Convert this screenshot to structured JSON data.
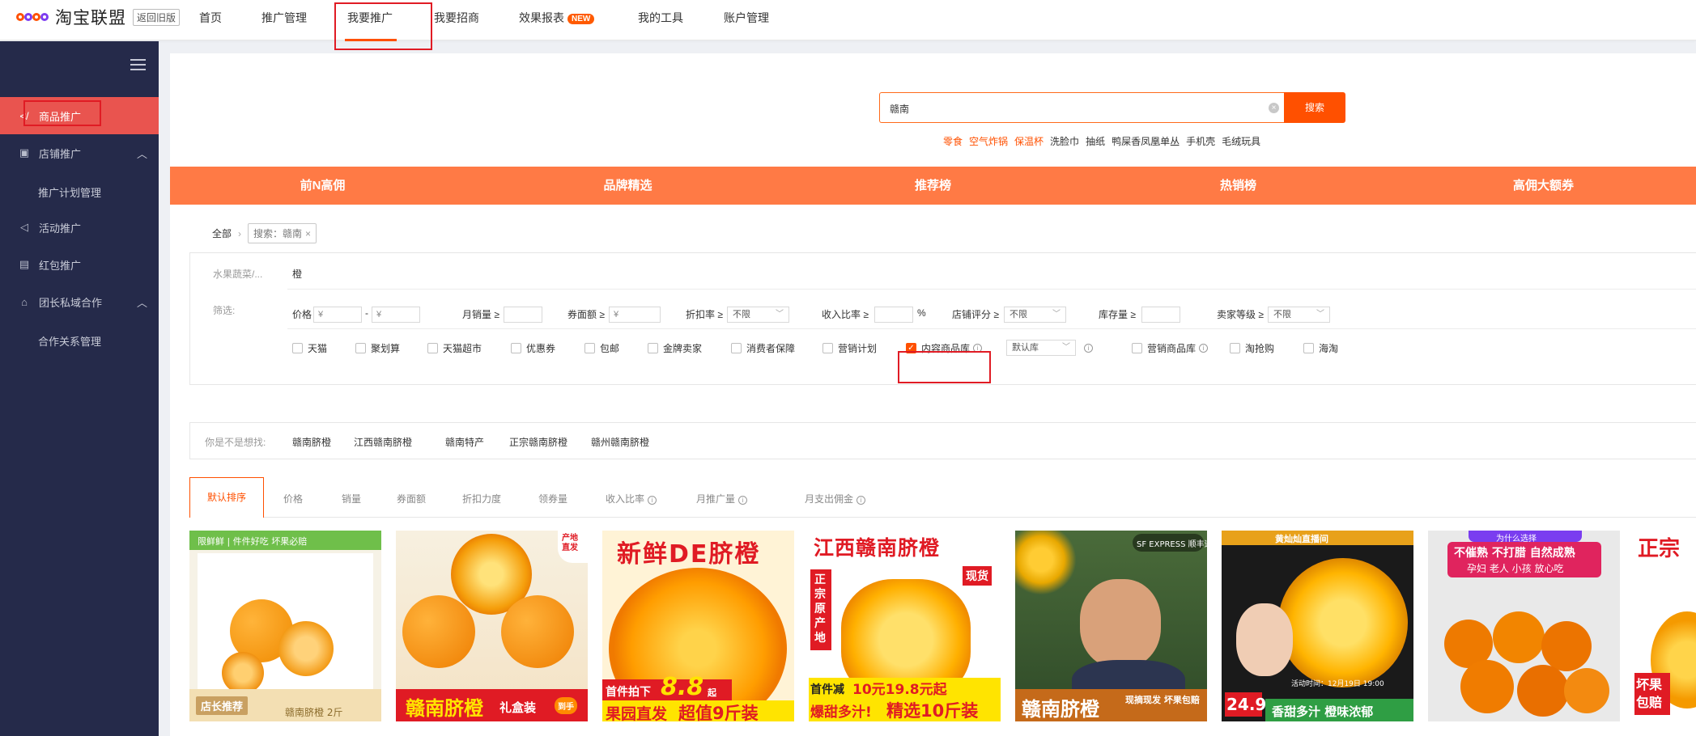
{
  "header": {
    "logo_text": "淘宝联盟",
    "old_version_label": "返回旧版",
    "nav": [
      "首页",
      "推广管理",
      "我要推广",
      "我要招商",
      "效果报表",
      "我的工具",
      "账户管理"
    ],
    "new_badge": "NEW"
  },
  "sidebar": {
    "items": [
      {
        "label": "商品推广",
        "icon": "share-icon"
      },
      {
        "label": "店铺推广",
        "icon": "store-icon"
      },
      {
        "label": "推广计划管理"
      },
      {
        "label": "活动推广",
        "icon": "megaphone-icon"
      },
      {
        "label": "红包推广",
        "icon": "red-packet-icon"
      },
      {
        "label": "团长私域合作",
        "icon": "lock-icon"
      },
      {
        "label": "合作关系管理"
      }
    ]
  },
  "search": {
    "value": "赣南",
    "button": "搜索",
    "hotwords": [
      "零食",
      "空气炸锅",
      "保温杯",
      "洗脸巾",
      "抽纸",
      "鸭屎香凤凰单丛",
      "手机壳",
      "毛绒玩具"
    ]
  },
  "banner": [
    "前N高佣",
    "品牌精选",
    "推荐榜",
    "热销榜",
    "高佣大额券"
  ],
  "breadcrumb": {
    "root": "全部",
    "tag": "搜索：赣南"
  },
  "filters": {
    "category_label": "水果蔬菜/...",
    "category_value": "橙",
    "filter_label": "筛选:",
    "price_label": "价格",
    "currency": "¥",
    "range_sep": "-",
    "monthly_sales_label": "月销量 ≥",
    "coupon_label": "券面额 ≥",
    "discount_label": "折扣率 ≥",
    "income_ratio_label": "收入比率 ≥",
    "percent": "%",
    "shop_score_label": "店铺评分 ≥",
    "stock_label": "库存量 ≥",
    "seller_level_label": "卖家等级 ≥",
    "unlimited": "不限",
    "checkboxes": [
      "天猫",
      "聚划算",
      "天猫超市",
      "优惠券",
      "包邮",
      "金牌卖家",
      "消费者保障",
      "营销计划",
      "内容商品库",
      "营销商品库",
      "淘抢购",
      "海淘"
    ],
    "default_lib": "默认库",
    "checked_index": 8
  },
  "suggest": {
    "label": "你是不是想找:",
    "items": [
      "赣南脐橙",
      "江西赣南脐橙",
      "赣南特产",
      "正宗赣南脐橙",
      "赣州赣南脐橙"
    ]
  },
  "sort": {
    "items": [
      "默认排序",
      "价格",
      "销量",
      "券面额",
      "折扣力度",
      "领券量",
      "收入比率",
      "月推广量",
      "月支出佣金"
    ]
  },
  "products": [
    {
      "banner": "限鲜鲜 | 件件好吃 坏果必赔",
      "tag": "店长推荐",
      "name": "赣南脐橙 2斤"
    },
    {
      "corner": "产地直发",
      "main": "赣南脐橙",
      "sub": "礼盒装",
      "badge": "到手"
    },
    {
      "top": "新鲜DE脐橙",
      "line1": "首件拍下",
      "price": "8.8",
      "unit": "起",
      "line2": "果园直发",
      "line3": "超值9斤装"
    },
    {
      "top": "江西赣南脐橙",
      "side": "正宗原产地",
      "stock": "现货",
      "line1": "首件减",
      "price": "10元19.8元起",
      "line2": "爆甜多汁!",
      "line3": "精选10斤装"
    },
    {
      "logo": "SF EXPRESS 顺丰速运",
      "main": "赣南脐橙",
      "sub": "现摘现发 坏果包赔"
    },
    {
      "top": "黄灿灿直播间",
      "live": "活动时间：12月19日 19:00",
      "price": "24.9",
      "sub": "香甜多汁 橙味浓郁"
    },
    {
      "q": "为什么选择",
      "l1": "不催熟 不打腊 自然成熟",
      "l2": "孕妇 老人 小孩 放心吃"
    },
    {
      "top": "正宗",
      "side": "坏果包赔"
    }
  ],
  "colors": {
    "accent": "#ff5000",
    "banner": "#ff7a45",
    "sidebar": "#252a4a",
    "sidebar_active": "#e9544f",
    "highlight_box": "#e01b24"
  }
}
